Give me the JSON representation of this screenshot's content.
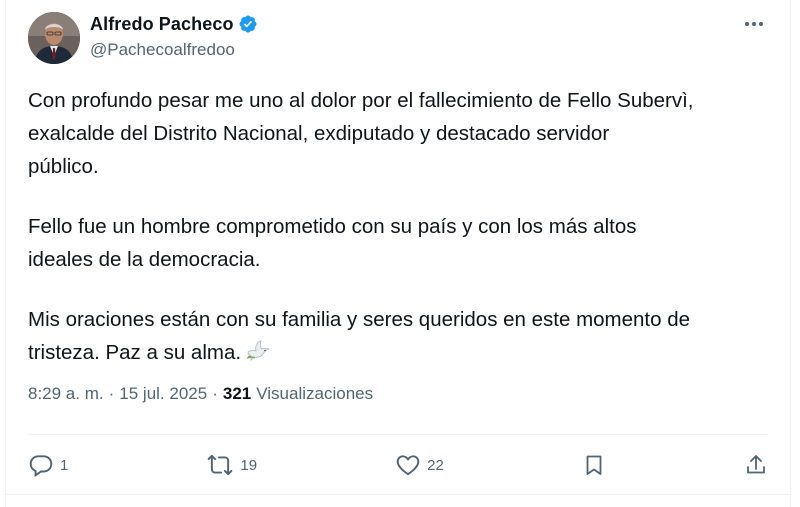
{
  "author": {
    "display_name": "Alfredo Pacheco",
    "handle": "@Pachecoalfredoo",
    "verified": true,
    "verified_color": "#1d9bf0"
  },
  "post": {
    "paragraphs": [
      "Con profundo pesar me uno al dolor por el fallecimiento de Fello Subervì,\nexalcalde del Distrito Nacional, exdiputado y destacado servidor\npúblico.",
      "Fello fue un hombre comprometido con su país y con los más altos\nideales de la democracia.",
      "Mis oraciones están con su familia y seres queridos en este momento de\ntristeza. Paz a su alma."
    ],
    "emoji": "dove-icon"
  },
  "meta": {
    "time": "8:29 a. m.",
    "separator": "·",
    "date": "15 jul. 2025",
    "views_count": "321",
    "views_label": "Visualizaciones"
  },
  "actions": {
    "replies": "1",
    "reposts": "19",
    "likes": "22"
  },
  "colors": {
    "text_primary": "#0f1419",
    "text_secondary": "#536471",
    "divider": "#eff3f4"
  }
}
